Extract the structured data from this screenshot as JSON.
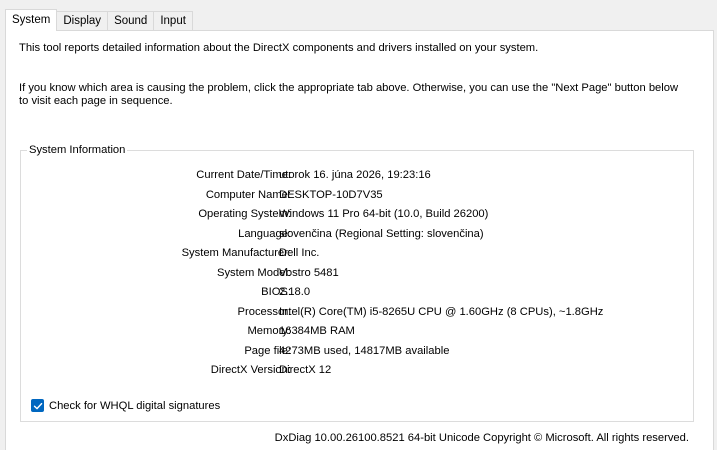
{
  "tabs": [
    {
      "label": "System"
    },
    {
      "label": "Display"
    },
    {
      "label": "Sound"
    },
    {
      "label": "Input"
    }
  ],
  "intro": {
    "line1": "This tool reports detailed information about the DirectX components and drivers installed on your system.",
    "line2": "If you know which area is causing the problem, click the appropriate tab above.  Otherwise, you can use the \"Next Page\" button below to visit each page in sequence."
  },
  "system_info": {
    "title": "System Information",
    "rows": [
      {
        "label": "Current Date/Time:",
        "value": "utorok 16. júna 2026, 19:23:16"
      },
      {
        "label": "Computer Name:",
        "value": "DESKTOP-10D7V35"
      },
      {
        "label": "Operating System:",
        "value": "Windows 11 Pro 64-bit (10.0, Build 26200)"
      },
      {
        "label": "Language:",
        "value": "slovenčina (Regional Setting: slovenčina)"
      },
      {
        "label": "System Manufacturer:",
        "value": "Dell Inc."
      },
      {
        "label": "System Model:",
        "value": "Vostro 5481"
      },
      {
        "label": "BIOS:",
        "value": "2.18.0"
      },
      {
        "label": "Processor:",
        "value": "Intel(R) Core(TM) i5-8265U CPU @ 1.60GHz (8 CPUs), ~1.8GHz"
      },
      {
        "label": "Memory:",
        "value": "16384MB RAM"
      },
      {
        "label": "Page file:",
        "value": "4273MB used, 14817MB available"
      },
      {
        "label": "DirectX Version:",
        "value": "DirectX 12"
      }
    ]
  },
  "whql": {
    "label": "Check for WHQL digital signatures",
    "checked": true
  },
  "footer": {
    "text": "DxDiag 10.00.26100.8521 64-bit Unicode  Copyright © Microsoft. All rights reserved."
  },
  "colors": {
    "accent": "#0067c0",
    "panel": "#ffffff",
    "background": "#f0f0f0"
  }
}
